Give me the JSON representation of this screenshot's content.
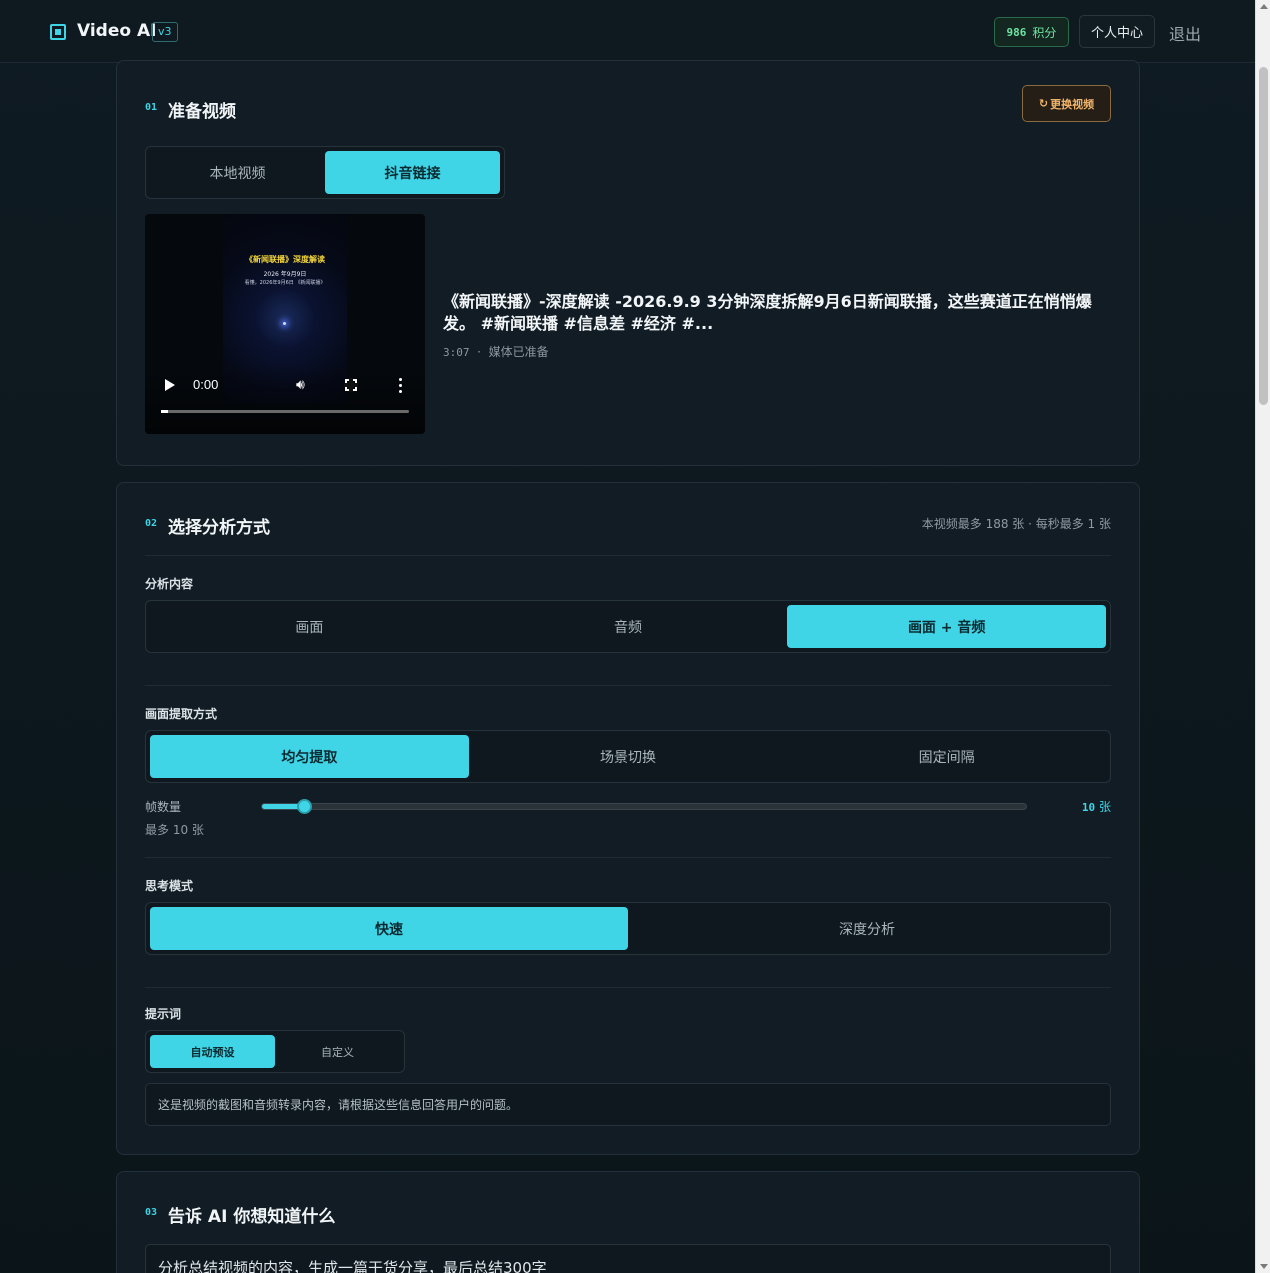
{
  "header": {
    "brand": "Video AI",
    "version": "v3",
    "points_value": "986",
    "points_label": "积分",
    "profile_label": "个人中心",
    "logout_label": "退出"
  },
  "step1": {
    "num": "01",
    "title": "准备视频",
    "change_label": "更换视频",
    "change_icon": "refresh-icon",
    "tabs": [
      {
        "label": "本地视频",
        "active": false
      },
      {
        "label": "抖音链接",
        "active": true
      }
    ],
    "video": {
      "frame_title": "《新闻联播》深度解读",
      "frame_date": "2026 年9月9日",
      "frame_sub": "看懂，2026年9月6日 《新闻联播》",
      "time": "0:00",
      "progress": 0.03
    },
    "info_title": "《新闻联播》-深度解读 -2026.9.9 3分钟深度拆解9月6日新闻联播，这些赛道正在悄悄爆发。 #新闻联播 #信息差 #经济 #...",
    "duration": "3:07",
    "separator": "·",
    "status": "媒体已准备"
  },
  "step2": {
    "num": "02",
    "title": "选择分析方式",
    "hint": "本视频最多 188 张 · 每秒最多 1 张",
    "content_label": "分析内容",
    "content_opts": [
      {
        "label": "画面",
        "active": false
      },
      {
        "label": "音频",
        "active": false
      },
      {
        "label": "画面 + 音频",
        "active": true
      }
    ],
    "extract_label": "画面提取方式",
    "extract_opts": [
      {
        "label": "均匀提取",
        "active": true
      },
      {
        "label": "场景切换",
        "active": false
      },
      {
        "label": "固定间隔",
        "active": false
      }
    ],
    "frames_label": "帧数量",
    "frames_value": "10",
    "frames_unit": "张",
    "frames_sub": "最多 10 张",
    "frames_fraction": 0.055,
    "think_label": "思考模式",
    "think_opts": [
      {
        "label": "快速",
        "active": true
      },
      {
        "label": "深度分析",
        "active": false
      }
    ],
    "prompt_label": "提示词",
    "prompt_opts": [
      {
        "label": "自动预设",
        "active": true
      },
      {
        "label": "自定义",
        "active": false
      }
    ],
    "prompt_text": "这是视频的截图和音频转录内容，请根据这些信息回答用户的问题。"
  },
  "step3": {
    "num": "03",
    "title": "告诉 AI 你想知道什么",
    "question": "分析总结视频的内容，生成一篇干货分享，最后总结300字"
  },
  "colors": {
    "accent": "#3fd5e6",
    "points_green": "#6fe3a4",
    "change_orange": "#f0b36a"
  }
}
